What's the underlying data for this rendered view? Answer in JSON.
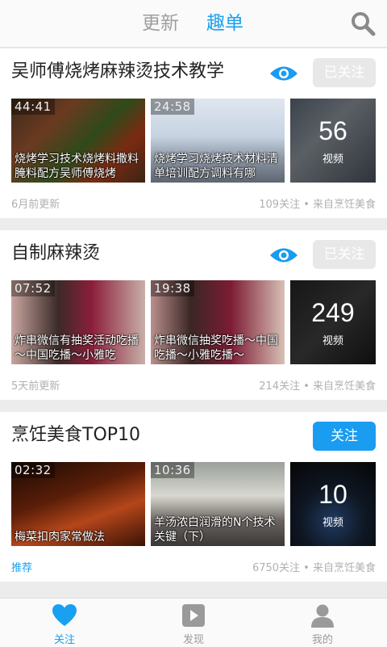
{
  "header": {
    "tab_updates": "更新",
    "tab_lists": "趣单"
  },
  "cards": [
    {
      "title": "吴师傅烧烤麻辣烫技术教学",
      "follow_label": "已关注",
      "videos": [
        {
          "duration": "44:41",
          "caption": "烧烤学习技术烧烤料撒料腌料配方吴师傅烧烤"
        },
        {
          "duration": "24:58",
          "caption": "烧烤学习烧烤技术材料清单培训配方调料有哪"
        }
      ],
      "count": "56",
      "count_label": "视频",
      "updated": "6月前更新",
      "stats": "109关注 • 来自烹饪美食"
    },
    {
      "title": "自制麻辣烫",
      "follow_label": "已关注",
      "videos": [
        {
          "duration": "07:52",
          "caption": "炸串微信有抽奖活动吃播～中国吃播～小雅吃"
        },
        {
          "duration": "19:38",
          "caption": "炸串微信抽奖吃播～中国吃播～小雅吃播～"
        }
      ],
      "count": "249",
      "count_label": "视频",
      "updated": "5天前更新",
      "stats": "214关注 • 来自烹饪美食"
    },
    {
      "title": "烹饪美食TOP10",
      "follow_label": "关注",
      "videos": [
        {
          "duration": "02:32",
          "caption": "梅菜扣肉家常做法"
        },
        {
          "duration": "10:36",
          "caption": "羊汤浓白润滑的N个技术关键（下）"
        }
      ],
      "count": "10",
      "count_label": "视频",
      "updated": "推荐",
      "stats": "6750关注 • 来自烹饪美食"
    }
  ],
  "nav": {
    "follow": "关注",
    "discover": "发现",
    "mine": "我的"
  },
  "colors": {
    "accent": "#1aa0f0",
    "followed_button": "#e8e8e8"
  }
}
